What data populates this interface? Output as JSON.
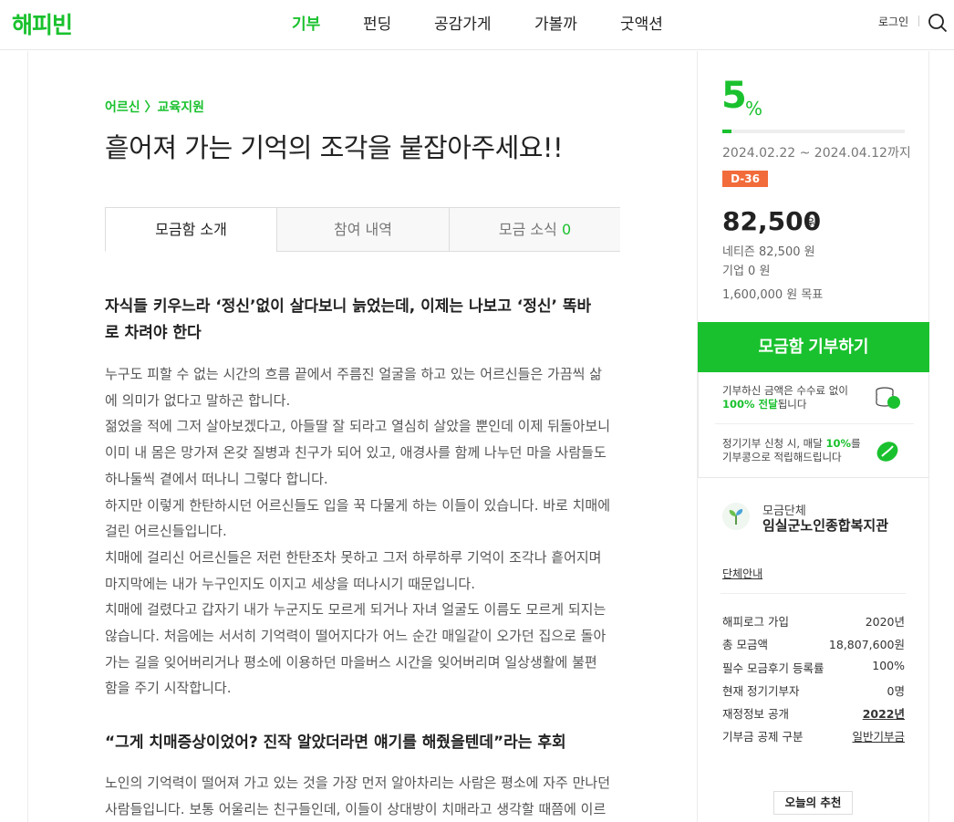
{
  "header": {
    "logo": "해피빈",
    "nav": [
      "기부",
      "펀딩",
      "공감가게",
      "가볼까",
      "굿액션"
    ],
    "login": "로그인"
  },
  "project": {
    "category": "어르신 〉교육지원",
    "title": "흩어져 가는 기억의 조각을 붙잡아주세요!!",
    "tabs": [
      {
        "label": "모금함 소개"
      },
      {
        "label": "참여 내역"
      },
      {
        "label": "모금 소식",
        "count": "0"
      }
    ]
  },
  "story": {
    "heading1": [
      "자식들 키우느라 ‘정신’없이 살다보니 늙었는데, 이제는 나보고 ‘정신’ 똑바",
      "로 차려야 한다"
    ],
    "body1": [
      "누구도 피할 수 없는 시간의 흐름 끝에서 주름진 얼굴을 하고 있는 어르신들은 가끔씩 삶",
      "에 의미가 없다고 말하곤 합니다.",
      "젊었을 적에 그저 살아보겠다고, 아들딸 잘 되라고 열심히 살았을 뿐인데 이제 뒤돌아보니",
      "이미 내 몸은 망가져 온갖 질병과 친구가 되어 있고, 애경사를 함께 나누던 마을 사람들도",
      "하나둘씩 곁에서 떠나니 그렇다 합니다.",
      "하지만 이렇게 한탄하시던 어르신들도 입을 꾹 다물게 하는 이들이 있습니다. 바로 치매에",
      "걸린 어르신들입니다.",
      "치매에 걸리신 어르신들은 저런 한탄조차 못하고 그저 하루하루 기억이 조각나 흩어지며",
      "마지막에는 내가 누구인지도 이지고 세상을 떠나시기 때문입니다.",
      "치매에 걸렸다고 갑자기 내가 누군지도 모르게 되거나 자녀 얼굴도 이름도 모르게 되지는",
      "않습니다. 처음에는 서서히 기억력이 떨어지다가 어느 순간 매일같이 오가던 집으로 돌아",
      "가는 길을 잊어버리거나 평소에 이용하던 마을버스 시간을 잊어버리며 일상생활에 불편",
      "함을 주기 시작합니다."
    ],
    "heading2": "“그게 치매증상이었어? 진작 알았더라면 얘기를 해줬을텐데”라는 후회",
    "body2": [
      "노인의 기억력이 떨어져 가고 있는 것을 가장 먼저 알아차리는 사람은 평소에 자주 만나던",
      "사람들입니다. 보통 어울리는 친구들인데, 이들이 상대방이 치매라고 생각할 때쯤에 이르"
    ]
  },
  "sidebar": {
    "percent": "5",
    "percent_unit": "%",
    "progress_fraction": 0.05,
    "period": "2024.02.22 ~ 2024.04.12까지",
    "dday": "D-36",
    "amount": "82,500",
    "amount_unit": "원",
    "netizen": "네티즌 82,500 원",
    "company": "기업 0 원",
    "goal": "1,600,000 원 목표",
    "donate_button": "모금함 기부하기",
    "info1_line1": "기부하신 금액은 수수료 없이",
    "info1_bold": "100% 전달",
    "info1_rest": "됩니다",
    "info2_pre": "정기기부 신청 시, 매달 ",
    "info2_bold": "10%",
    "info2_post": "를",
    "info2_line2": "기부콩으로 적립해드립니다",
    "org_label": "모금단체",
    "org_name": "임실군노인종합복지관",
    "org_link": "단체안내",
    "stats": [
      {
        "k": "해피로그 가입",
        "v": "2020년"
      },
      {
        "k": "총 모금액",
        "v": "18,807,600원"
      },
      {
        "k": "필수 모금후기 등록률",
        "v": "100%"
      },
      {
        "k": "현재 정기기부자",
        "v": "0명"
      },
      {
        "k": "재정정보 공개",
        "v": "2022년"
      },
      {
        "k": "기부금 공제 구분",
        "v": "일반기부금"
      }
    ],
    "today": "오늘의 추천"
  },
  "colors": {
    "brand": "#1ac12e",
    "dday": "#f26b3a"
  }
}
